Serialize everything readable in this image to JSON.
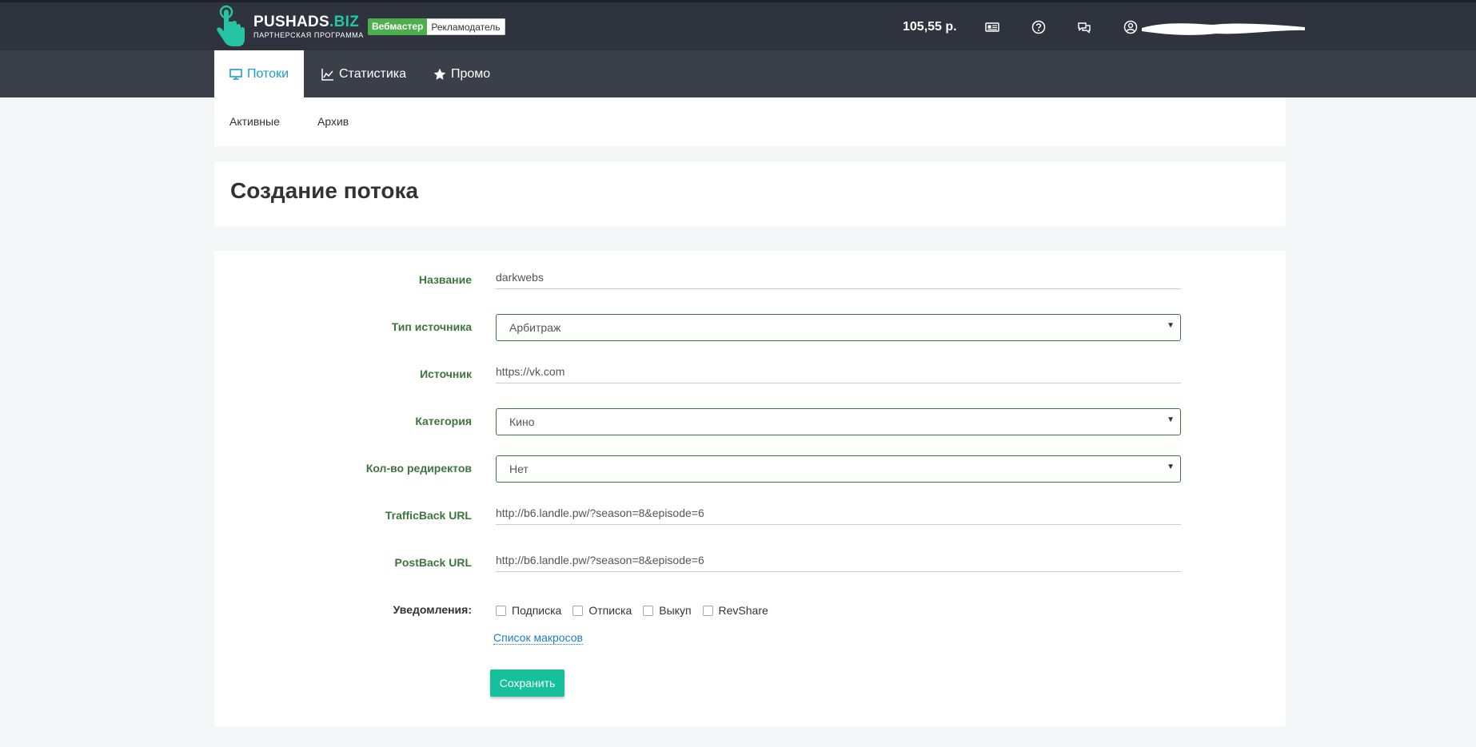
{
  "header": {
    "brand": {
      "name_main": "PUSHADS",
      "name_accent": ".BIZ",
      "subtitle": "ПАРТНЕРСКАЯ ПРОГРАММА"
    },
    "roles": {
      "active": "Вебмастер",
      "inactive": "Рекламодатель"
    },
    "balance": "105,55 р.",
    "icons": [
      "news-icon",
      "help-icon",
      "chat-icon",
      "user-icon"
    ]
  },
  "nav": {
    "tabs": [
      {
        "label": "Потоки",
        "icon": "monitor-icon",
        "active": true
      },
      {
        "label": "Статистика",
        "icon": "line-chart-icon",
        "active": false
      },
      {
        "label": "Промо",
        "icon": "star-icon",
        "active": false
      }
    ]
  },
  "subnav": {
    "items": [
      "Активные",
      "Архив"
    ]
  },
  "page": {
    "title": "Создание потока"
  },
  "form": {
    "name": {
      "label": "Название",
      "value": "darkwebs"
    },
    "source_type": {
      "label": "Тип источника",
      "value": "Арбитраж"
    },
    "source": {
      "label": "Источник",
      "value": "https://vk.com"
    },
    "category": {
      "label": "Категория",
      "value": "Кино"
    },
    "redirects": {
      "label": "Кол-во редиректов",
      "value": "Нет"
    },
    "trafficback": {
      "label": "TrafficBack URL",
      "value": "http://b6.landle.pw/?season=8&episode=6"
    },
    "postback": {
      "label": "PostBack URL",
      "value": "http://b6.landle.pw/?season=8&episode=6"
    },
    "notifications": {
      "label": "Уведомления:",
      "options": [
        "Подписка",
        "Отписка",
        "Выкуп",
        "RevShare"
      ]
    },
    "macros_link": "Список макросов",
    "save_label": "Сохранить"
  },
  "colors": {
    "topbar": "#2f333d",
    "navbar": "#3b3f4a",
    "accent_teal": "#25c5a4",
    "label_green": "#3c763d",
    "save_button": "#16c09a",
    "link_blue": "#1a7fbf"
  }
}
